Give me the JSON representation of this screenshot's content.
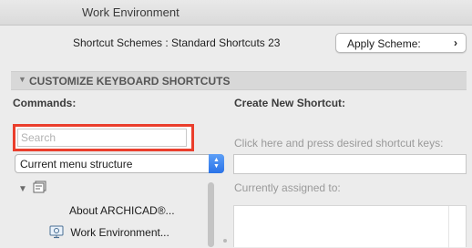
{
  "window": {
    "title": "Work Environment"
  },
  "scheme": {
    "label": "Shortcut Schemes : Standard Shortcuts 23",
    "apply_button": "Apply Scheme:",
    "apply_chevron": "›"
  },
  "section": {
    "title": "CUSTOMIZE KEYBOARD SHORTCUTS",
    "expanded_glyph": "▼"
  },
  "commands": {
    "title": "Commands:",
    "search_placeholder": "Search",
    "filter": {
      "selected": "Current menu structure",
      "stepper_up": "▲",
      "stepper_down": "▼"
    },
    "tree": {
      "root_disclosure": "▼",
      "items": [
        {
          "label": "About ARCHICAD®...",
          "icon": null
        },
        {
          "label": "Work Environment...",
          "icon": "work-environment-icon"
        }
      ]
    }
  },
  "create": {
    "title": "Create New Shortcut:",
    "hint": "Click here and press desired shortcut keys:",
    "assigned_label": "Currently assigned to:"
  },
  "colors": {
    "highlight": "#ea3e2c",
    "accent": "#2a73e8"
  }
}
